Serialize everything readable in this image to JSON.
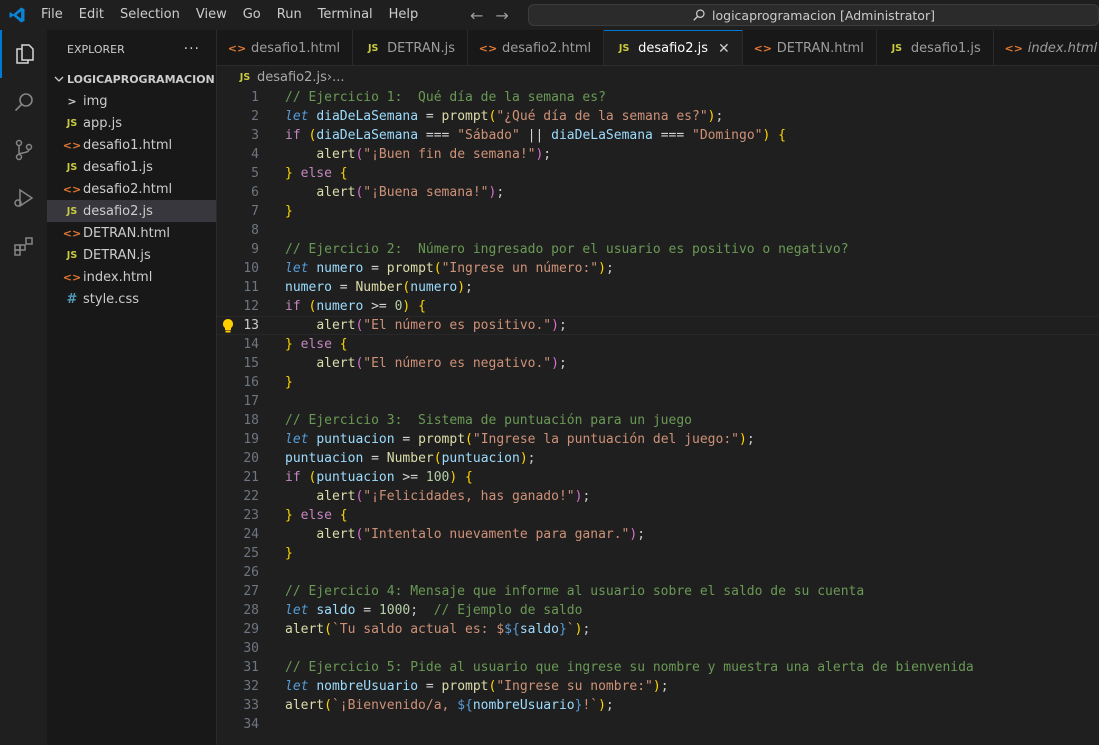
{
  "menu": [
    "File",
    "Edit",
    "Selection",
    "View",
    "Go",
    "Run",
    "Terminal",
    "Help"
  ],
  "search": {
    "text": "logicaprogramacion [Administrator]"
  },
  "sidebar": {
    "title": "EXPLORER",
    "more": "···",
    "folder": "LOGICAPROGRAMACION",
    "items": [
      {
        "label": "img",
        "type": "folder",
        "icon": ">"
      },
      {
        "label": "app.js",
        "type": "js",
        "icon": "JS"
      },
      {
        "label": "desafio1.html",
        "type": "html",
        "icon": "<>"
      },
      {
        "label": "desafio1.js",
        "type": "js",
        "icon": "JS"
      },
      {
        "label": "desafio2.html",
        "type": "html",
        "icon": "<>"
      },
      {
        "label": "desafio2.js",
        "type": "js",
        "icon": "JS",
        "selected": true
      },
      {
        "label": "DETRAN.html",
        "type": "html",
        "icon": "<>"
      },
      {
        "label": "DETRAN.js",
        "type": "js",
        "icon": "JS"
      },
      {
        "label": "index.html",
        "type": "html",
        "icon": "<>"
      },
      {
        "label": "style.css",
        "type": "css",
        "icon": "#"
      }
    ]
  },
  "tabs": [
    {
      "label": "desafio1.html",
      "type": "html",
      "icon": "<>"
    },
    {
      "label": "DETRAN.js",
      "type": "js",
      "icon": "JS"
    },
    {
      "label": "desafio2.html",
      "type": "html",
      "icon": "<>"
    },
    {
      "label": "desafio2.js",
      "type": "js",
      "icon": "JS",
      "active": true,
      "close": "✕"
    },
    {
      "label": "DETRAN.html",
      "type": "html",
      "icon": "<>"
    },
    {
      "label": "desafio1.js",
      "type": "js",
      "icon": "JS"
    },
    {
      "label": "index.html",
      "type": "html",
      "icon": "<>",
      "preview": true
    }
  ],
  "breadcrumb": {
    "icon": "JS",
    "file": "desafio2.js",
    "sep": " › ",
    "rest": "..."
  },
  "editor": {
    "current_line": 13,
    "lines": [
      [
        [
          "c-com",
          "// Ejercicio 1:  Qué día de la semana es?"
        ]
      ],
      [
        [
          "c-kw",
          "let"
        ],
        [
          "c-white",
          " "
        ],
        [
          "c-var",
          "diaDeLaSemana"
        ],
        [
          "c-op",
          " = "
        ],
        [
          "c-fn",
          "prompt"
        ],
        [
          "c-p1",
          "("
        ],
        [
          "c-str",
          "\"¿Qué día de la semana es?\""
        ],
        [
          "c-p1",
          ")"
        ],
        [
          "c-white",
          ";"
        ]
      ],
      [
        [
          "c-ctl",
          "if"
        ],
        [
          "c-white",
          " "
        ],
        [
          "c-p1",
          "("
        ],
        [
          "c-var",
          "diaDeLaSemana"
        ],
        [
          "c-op",
          " === "
        ],
        [
          "c-str",
          "\"Sábado\""
        ],
        [
          "c-op",
          " || "
        ],
        [
          "c-var",
          "diaDeLaSemana"
        ],
        [
          "c-op",
          " === "
        ],
        [
          "c-str",
          "\"Domingo\""
        ],
        [
          "c-p1",
          ")"
        ],
        [
          "c-white",
          " "
        ],
        [
          "c-p1",
          "{"
        ]
      ],
      [
        [
          "c-white",
          "    "
        ],
        [
          "c-fn",
          "alert"
        ],
        [
          "c-p2",
          "("
        ],
        [
          "c-str",
          "\"¡Buen fin de semana!\""
        ],
        [
          "c-p2",
          ")"
        ],
        [
          "c-white",
          ";"
        ]
      ],
      [
        [
          "c-p1",
          "}"
        ],
        [
          "c-white",
          " "
        ],
        [
          "c-ctl",
          "else"
        ],
        [
          "c-white",
          " "
        ],
        [
          "c-p1",
          "{"
        ]
      ],
      [
        [
          "c-white",
          "    "
        ],
        [
          "c-fn",
          "alert"
        ],
        [
          "c-p2",
          "("
        ],
        [
          "c-str",
          "\"¡Buena semana!\""
        ],
        [
          "c-p2",
          ")"
        ],
        [
          "c-white",
          ";"
        ]
      ],
      [
        [
          "c-p1",
          "}"
        ]
      ],
      [],
      [
        [
          "c-com",
          "// Ejercicio 2:  Número ingresado por el usuario es positivo o negativo?"
        ]
      ],
      [
        [
          "c-kw",
          "let"
        ],
        [
          "c-white",
          " "
        ],
        [
          "c-var",
          "numero"
        ],
        [
          "c-op",
          " = "
        ],
        [
          "c-fn",
          "prompt"
        ],
        [
          "c-p1",
          "("
        ],
        [
          "c-str",
          "\"Ingrese un número:\""
        ],
        [
          "c-p1",
          ")"
        ],
        [
          "c-white",
          ";"
        ]
      ],
      [
        [
          "c-var",
          "numero"
        ],
        [
          "c-op",
          " = "
        ],
        [
          "c-fn",
          "Number"
        ],
        [
          "c-p1",
          "("
        ],
        [
          "c-var",
          "numero"
        ],
        [
          "c-p1",
          ")"
        ],
        [
          "c-white",
          ";"
        ]
      ],
      [
        [
          "c-ctl",
          "if"
        ],
        [
          "c-white",
          " "
        ],
        [
          "c-p1",
          "("
        ],
        [
          "c-var",
          "numero"
        ],
        [
          "c-op",
          " >= "
        ],
        [
          "c-num",
          "0"
        ],
        [
          "c-p1",
          ")"
        ],
        [
          "c-white",
          " "
        ],
        [
          "c-p1",
          "{"
        ]
      ],
      [
        [
          "c-white",
          "    "
        ],
        [
          "c-fn",
          "alert"
        ],
        [
          "c-p2",
          "("
        ],
        [
          "c-str",
          "\"El número es positivo.\""
        ],
        [
          "c-p2",
          ")"
        ],
        [
          "c-white",
          ";"
        ]
      ],
      [
        [
          "c-p1",
          "}"
        ],
        [
          "c-white",
          " "
        ],
        [
          "c-ctl",
          "else"
        ],
        [
          "c-white",
          " "
        ],
        [
          "c-p1",
          "{"
        ]
      ],
      [
        [
          "c-white",
          "    "
        ],
        [
          "c-fn",
          "alert"
        ],
        [
          "c-p2",
          "("
        ],
        [
          "c-str",
          "\"El número es negativo.\""
        ],
        [
          "c-p2",
          ")"
        ],
        [
          "c-white",
          ";"
        ]
      ],
      [
        [
          "c-p1",
          "}"
        ]
      ],
      [],
      [
        [
          "c-com",
          "// Ejercicio 3:  Sistema de puntuación para un juego"
        ]
      ],
      [
        [
          "c-kw",
          "let"
        ],
        [
          "c-white",
          " "
        ],
        [
          "c-var",
          "puntuacion"
        ],
        [
          "c-op",
          " = "
        ],
        [
          "c-fn",
          "prompt"
        ],
        [
          "c-p1",
          "("
        ],
        [
          "c-str",
          "\"Ingrese la puntuación del juego:\""
        ],
        [
          "c-p1",
          ")"
        ],
        [
          "c-white",
          ";"
        ]
      ],
      [
        [
          "c-var",
          "puntuacion"
        ],
        [
          "c-op",
          " = "
        ],
        [
          "c-fn",
          "Number"
        ],
        [
          "c-p1",
          "("
        ],
        [
          "c-var",
          "puntuacion"
        ],
        [
          "c-p1",
          ")"
        ],
        [
          "c-white",
          ";"
        ]
      ],
      [
        [
          "c-ctl",
          "if"
        ],
        [
          "c-white",
          " "
        ],
        [
          "c-p1",
          "("
        ],
        [
          "c-var",
          "puntuacion"
        ],
        [
          "c-op",
          " >= "
        ],
        [
          "c-num",
          "100"
        ],
        [
          "c-p1",
          ")"
        ],
        [
          "c-white",
          " "
        ],
        [
          "c-p1",
          "{"
        ]
      ],
      [
        [
          "c-white",
          "    "
        ],
        [
          "c-fn",
          "alert"
        ],
        [
          "c-p2",
          "("
        ],
        [
          "c-str",
          "\"¡Felicidades, has ganado!\""
        ],
        [
          "c-p2",
          ")"
        ],
        [
          "c-white",
          ";"
        ]
      ],
      [
        [
          "c-p1",
          "}"
        ],
        [
          "c-white",
          " "
        ],
        [
          "c-ctl",
          "else"
        ],
        [
          "c-white",
          " "
        ],
        [
          "c-p1",
          "{"
        ]
      ],
      [
        [
          "c-white",
          "    "
        ],
        [
          "c-fn",
          "alert"
        ],
        [
          "c-p2",
          "("
        ],
        [
          "c-str",
          "\"Intentalo nuevamente para ganar.\""
        ],
        [
          "c-p2",
          ")"
        ],
        [
          "c-white",
          ";"
        ]
      ],
      [
        [
          "c-p1",
          "}"
        ]
      ],
      [],
      [
        [
          "c-com",
          "// Ejercicio 4: Mensaje que informe al usuario sobre el saldo de su cuenta"
        ]
      ],
      [
        [
          "c-kw",
          "let"
        ],
        [
          "c-white",
          " "
        ],
        [
          "c-var",
          "saldo"
        ],
        [
          "c-op",
          " = "
        ],
        [
          "c-num",
          "1000"
        ],
        [
          "c-white",
          ";  "
        ],
        [
          "c-com",
          "// Ejemplo de saldo"
        ]
      ],
      [
        [
          "c-fn",
          "alert"
        ],
        [
          "c-p1",
          "("
        ],
        [
          "c-str",
          "`Tu saldo actual es: $"
        ],
        [
          "c-tmpl",
          "${"
        ],
        [
          "c-var",
          "saldo"
        ],
        [
          "c-tmpl",
          "}"
        ],
        [
          "c-str",
          "`"
        ],
        [
          "c-p1",
          ")"
        ],
        [
          "c-white",
          ";"
        ]
      ],
      [],
      [
        [
          "c-com",
          "// Ejercicio 5: Pide al usuario que ingrese su nombre y muestra una alerta de bienvenida"
        ]
      ],
      [
        [
          "c-kw",
          "let"
        ],
        [
          "c-white",
          " "
        ],
        [
          "c-var",
          "nombreUsuario"
        ],
        [
          "c-op",
          " = "
        ],
        [
          "c-fn",
          "prompt"
        ],
        [
          "c-p1",
          "("
        ],
        [
          "c-str",
          "\"Ingrese su nombre:\""
        ],
        [
          "c-p1",
          ")"
        ],
        [
          "c-white",
          ";"
        ]
      ],
      [
        [
          "c-fn",
          "alert"
        ],
        [
          "c-p1",
          "("
        ],
        [
          "c-str",
          "`¡Bienvenido/a, "
        ],
        [
          "c-tmpl",
          "${"
        ],
        [
          "c-var",
          "nombreUsuario"
        ],
        [
          "c-tmpl",
          "}"
        ],
        [
          "c-str",
          "!`"
        ],
        [
          "c-p1",
          ")"
        ],
        [
          "c-white",
          ";"
        ]
      ],
      []
    ]
  }
}
